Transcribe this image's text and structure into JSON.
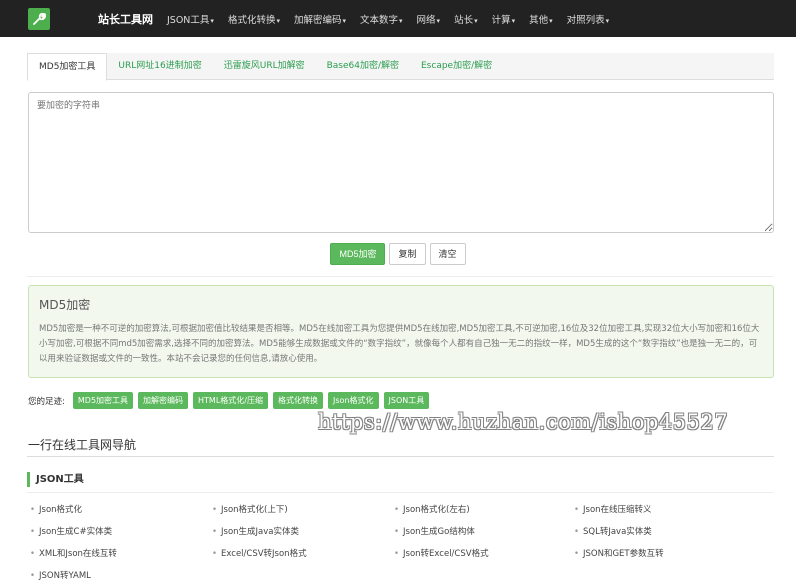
{
  "nav": {
    "brand": "站长工具网",
    "items": [
      "JSON工具",
      "格式化转换",
      "加解密编码",
      "文本数字",
      "网络",
      "站长",
      "计算",
      "其他",
      "对照列表"
    ]
  },
  "tabs": [
    "MD5加密工具",
    "URL网址16进制加密",
    "迅雷旋风URL加解密",
    "Base64加密/解密",
    "Escape加密/解密"
  ],
  "input": {
    "placeholder": "要加密的字符串"
  },
  "buttons": {
    "encrypt": "MD5加密",
    "copy": "复制",
    "clear": "清空"
  },
  "panel": {
    "title": "MD5加密",
    "body": "MD5加密是一种不可逆的加密算法,可根据加密值比较结果是否相等。MD5在线加密工具为您提供MD5在线加密,MD5加密工具,不可逆加密,16位及32位加密工具,实现32位大小写加密和16位大小写加密,可根据不同md5加密需求,选择不同的加密算法。MD5能够生成数据或文件的“数字指纹”，就像每个人都有自己独一无二的指纹一样，MD5生成的这个“数字指纹”也是独一无二的，可以用来验证数据或文件的一致性。本站不会记录您的任何信息,请放心使用。"
  },
  "footprint": {
    "label": "您的足迹:",
    "tags": [
      "MD5加密工具",
      "加解密编码",
      "HTML格式化/压缩",
      "格式化转换",
      "Json格式化",
      "JSON工具"
    ]
  },
  "watermark": "https://www.huzhan.com/ishop45527",
  "nav_section": {
    "title": "一行在线工具网导航",
    "category": "JSON工具",
    "links": [
      "Json格式化",
      "Json格式化(上下)",
      "Json格式化(左右)",
      "Json在线压缩转义",
      "Json生成C#实体类",
      "Json生成Java实体类",
      "Json生成Go结构体",
      "SQL转Java实体类",
      "XML和Json在线互转",
      "Excel/CSV转Json格式",
      "Json转Excel/CSV格式",
      "JSON和GET参数互转",
      "JSON转YAML"
    ]
  },
  "colors": {
    "accent": "#5cb85c",
    "link": "#2a9d4e",
    "nav_bg": "#222222"
  },
  "icons": {
    "logo": "wrench-icon",
    "caret": "caret-down-icon"
  }
}
